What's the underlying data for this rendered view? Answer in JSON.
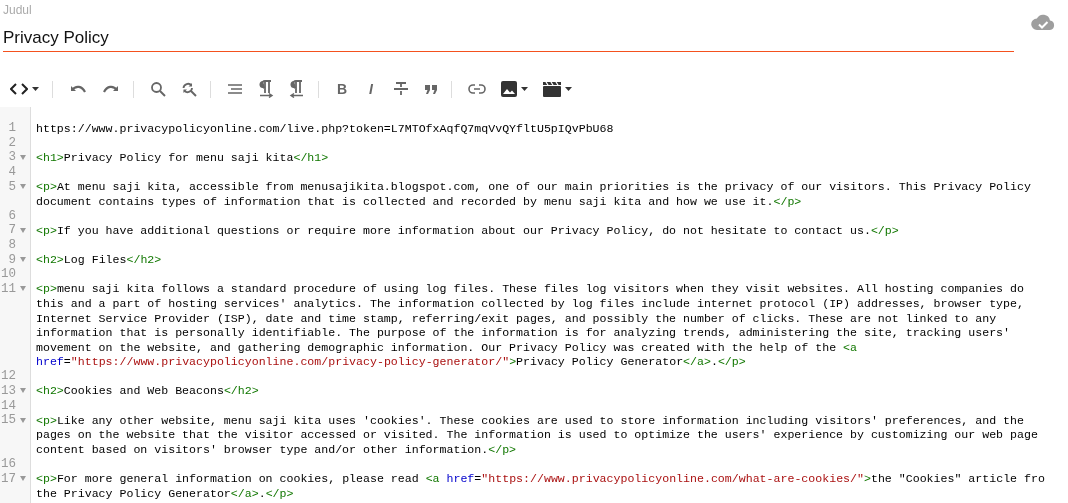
{
  "title_field": {
    "label": "Judul",
    "value": "Privacy Policy",
    "focused": true
  },
  "toolbar": [
    {
      "kind": "code"
    },
    {
      "kind": "separator"
    },
    {
      "kind": "undo"
    },
    {
      "kind": "redo"
    },
    {
      "kind": "separator"
    },
    {
      "kind": "search"
    },
    {
      "kind": "replace"
    },
    {
      "kind": "separator"
    },
    {
      "kind": "align"
    },
    {
      "kind": "ltr"
    },
    {
      "kind": "rtl"
    },
    {
      "kind": "separator"
    },
    {
      "kind": "bold",
      "label": "B"
    },
    {
      "kind": "italic",
      "label": "I"
    },
    {
      "kind": "strike"
    },
    {
      "kind": "quote"
    },
    {
      "kind": "separator"
    },
    {
      "kind": "link"
    },
    {
      "kind": "image"
    },
    {
      "kind": "video"
    }
  ],
  "lines": [
    {
      "number": "1",
      "foldable": false,
      "rows": [
        {
          "tokens": [
            {
              "kind": "text",
              "text": "https://www.privacypolicyonline.com/live.php?token=L7MTOfxAqfQ7mqVvQYfltU5pIQvPbU68"
            }
          ]
        }
      ]
    },
    {
      "number": "2",
      "foldable": false,
      "rows": [
        {
          "tokens": []
        }
      ]
    },
    {
      "number": "3",
      "foldable": true,
      "rows": [
        {
          "tokens": [
            {
              "kind": "tag",
              "text": "<h1>"
            },
            {
              "kind": "text",
              "text": "Privacy Policy for menu saji kita"
            },
            {
              "kind": "tag",
              "text": "</h1>"
            }
          ]
        }
      ]
    },
    {
      "number": "4",
      "foldable": false,
      "rows": [
        {
          "tokens": []
        }
      ]
    },
    {
      "number": "5",
      "foldable": true,
      "rows": [
        {
          "tokens": [
            {
              "kind": "tag",
              "text": "<p>"
            },
            {
              "kind": "text",
              "text": "At menu saji kita, accessible from menusajikita.blogspot.com, one of our main priorities is the privacy of our visitors. This Privacy Policy"
            }
          ]
        },
        {
          "tokens": [
            {
              "kind": "text",
              "text": "document contains types of information that is collected and recorded by menu saji kita and how we use it."
            },
            {
              "kind": "tag",
              "text": "</p>"
            }
          ]
        }
      ]
    },
    {
      "number": "6",
      "foldable": false,
      "rows": [
        {
          "tokens": []
        }
      ]
    },
    {
      "number": "7",
      "foldable": true,
      "rows": [
        {
          "tokens": [
            {
              "kind": "tag",
              "text": "<p>"
            },
            {
              "kind": "text",
              "text": "If you have additional questions or require more information about our Privacy Policy, do not hesitate to contact us."
            },
            {
              "kind": "tag",
              "text": "</p>"
            }
          ]
        }
      ]
    },
    {
      "number": "8",
      "foldable": false,
      "rows": [
        {
          "tokens": []
        }
      ]
    },
    {
      "number": "9",
      "foldable": true,
      "rows": [
        {
          "tokens": [
            {
              "kind": "tag",
              "text": "<h2>"
            },
            {
              "kind": "text",
              "text": "Log Files"
            },
            {
              "kind": "tag",
              "text": "</h2>"
            }
          ]
        }
      ]
    },
    {
      "number": "10",
      "foldable": false,
      "rows": [
        {
          "tokens": []
        }
      ]
    },
    {
      "number": "11",
      "foldable": true,
      "rows": [
        {
          "tokens": [
            {
              "kind": "tag",
              "text": "<p>"
            },
            {
              "kind": "text",
              "text": "menu saji kita follows a standard procedure of using log files. These files log visitors when they visit websites. All hosting companies do"
            }
          ]
        },
        {
          "tokens": [
            {
              "kind": "text",
              "text": "this and a part of hosting services' analytics. The information collected by log files include internet protocol (IP) addresses, browser type,"
            }
          ]
        },
        {
          "tokens": [
            {
              "kind": "text",
              "text": "Internet Service Provider (ISP), date and time stamp, referring/exit pages, and possibly the number of clicks. These are not linked to any"
            }
          ]
        },
        {
          "tokens": [
            {
              "kind": "text",
              "text": "information that is personally identifiable. The purpose of the information is for analyzing trends, administering the site, tracking users'"
            }
          ]
        },
        {
          "tokens": [
            {
              "kind": "text",
              "text": "movement on the website, and gathering demographic information. Our Privacy Policy was created with the help of the "
            },
            {
              "kind": "tag",
              "text": "<a"
            }
          ]
        },
        {
          "tokens": [
            {
              "kind": "attr",
              "text": "href"
            },
            {
              "kind": "text",
              "text": "="
            },
            {
              "kind": "string",
              "text": "\"https://www.privacypolicyonline.com/privacy-policy-generator/\""
            },
            {
              "kind": "tag",
              "text": ">"
            },
            {
              "kind": "text",
              "text": "Privacy Policy Generator"
            },
            {
              "kind": "tag",
              "text": "</a>"
            },
            {
              "kind": "text",
              "text": "."
            },
            {
              "kind": "tag",
              "text": "</p>"
            }
          ]
        }
      ]
    },
    {
      "number": "12",
      "foldable": false,
      "rows": [
        {
          "tokens": []
        }
      ]
    },
    {
      "number": "13",
      "foldable": true,
      "rows": [
        {
          "tokens": [
            {
              "kind": "tag",
              "text": "<h2>"
            },
            {
              "kind": "text",
              "text": "Cookies and Web Beacons"
            },
            {
              "kind": "tag",
              "text": "</h2>"
            }
          ]
        }
      ]
    },
    {
      "number": "14",
      "foldable": false,
      "rows": [
        {
          "tokens": []
        }
      ]
    },
    {
      "number": "15",
      "foldable": true,
      "rows": [
        {
          "tokens": [
            {
              "kind": "tag",
              "text": "<p>"
            },
            {
              "kind": "text",
              "text": "Like any other website, menu saji kita uses 'cookies'. These cookies are used to store information including visitors' preferences, and the"
            }
          ]
        },
        {
          "tokens": [
            {
              "kind": "text",
              "text": "pages on the website that the visitor accessed or visited. The information is used to optimize the users' experience by customizing our web page"
            }
          ]
        },
        {
          "tokens": [
            {
              "kind": "text",
              "text": "content based on visitors' browser type and/or other information."
            },
            {
              "kind": "tag",
              "text": "</p>"
            }
          ]
        }
      ]
    },
    {
      "number": "16",
      "foldable": false,
      "rows": [
        {
          "tokens": []
        }
      ]
    },
    {
      "number": "17",
      "foldable": true,
      "rows": [
        {
          "tokens": [
            {
              "kind": "tag",
              "text": "<p>"
            },
            {
              "kind": "text",
              "text": "For more general information on cookies, please read "
            },
            {
              "kind": "tag",
              "text": "<a "
            },
            {
              "kind": "attr",
              "text": "href"
            },
            {
              "kind": "text",
              "text": "="
            },
            {
              "kind": "string",
              "text": "\"https://www.privacypolicyonline.com/what-are-cookies/\""
            },
            {
              "kind": "tag",
              "text": ">"
            },
            {
              "kind": "text",
              "text": "the \"Cookies\" article fro"
            }
          ]
        },
        {
          "tokens": [
            {
              "kind": "text",
              "text": "the Privacy Policy Generator"
            },
            {
              "kind": "tag",
              "text": "</a>"
            },
            {
              "kind": "text",
              "text": "."
            },
            {
              "kind": "tag",
              "text": "</p>"
            }
          ]
        }
      ]
    }
  ]
}
